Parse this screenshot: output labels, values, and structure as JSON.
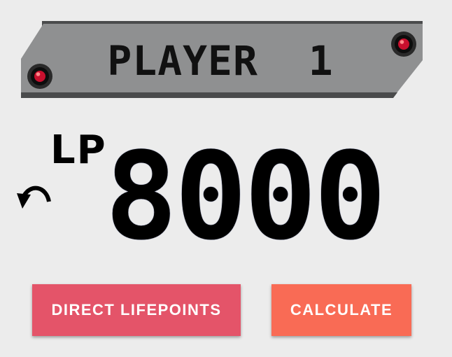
{
  "player": {
    "title": "PLAYER  1"
  },
  "life_points": {
    "label": "LP",
    "value": "8000"
  },
  "icons": {
    "undo": "undo-arrow-icon",
    "bolt": "red-rivet-icon"
  },
  "buttons": {
    "direct": "DIRECT LIFEPOINTS",
    "calculate": "CALCULATE"
  },
  "colors": {
    "background": "#ececec",
    "banner": "#8f9091",
    "banner_edge": "#4a4b4c",
    "direct_button": "#e45469",
    "calculate_button": "#f96b55",
    "rivet": "#c8102e"
  }
}
